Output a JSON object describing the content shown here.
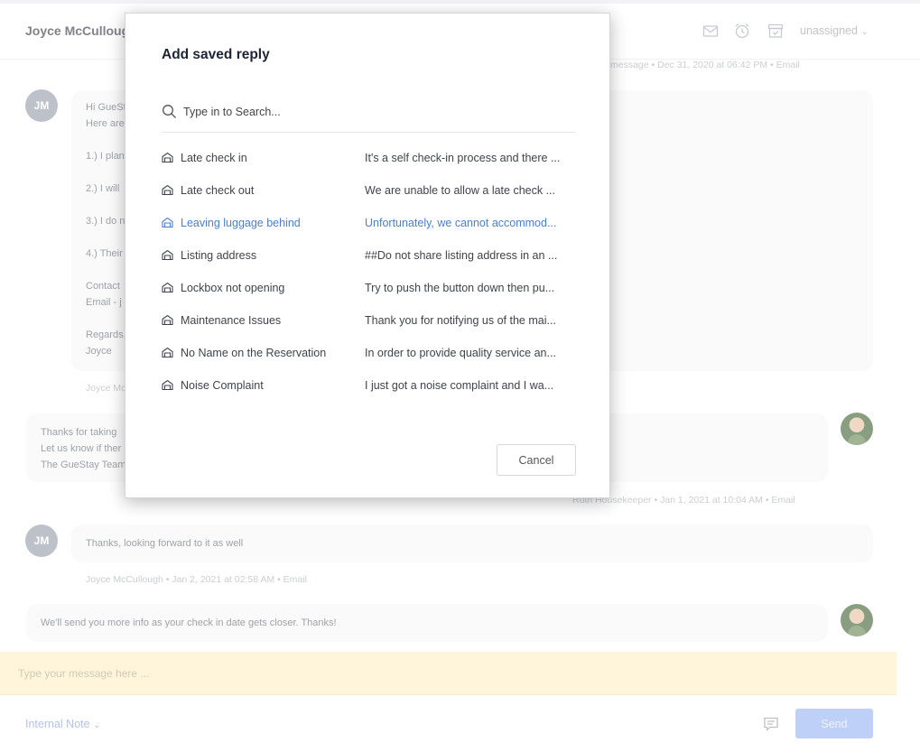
{
  "header": {
    "guest_name": "Joyce McCullough",
    "assignee": "unassigned"
  },
  "conversation": {
    "msg1": {
      "avatar": "JM",
      "meta": "message • Dec 31, 2020 at 06:42 PM • Email",
      "lines": [
        "Hi GueSt",
        "Here are",
        "",
        "1.) I plan",
        "",
        "2.) I will",
        "",
        "3.) I do n",
        "",
        "4.) Their",
        "",
        "Contact",
        "Email - j",
        "",
        "Regards,",
        "Joyce"
      ],
      "footer": "Joyce Mc"
    },
    "msg2": {
      "lines": [
        "Thanks for taking",
        "Let us know if ther",
        "The GueStay Team"
      ],
      "meta": "Ruth Housekeeper • Jan 1, 2021 at 10:04 AM • Email"
    },
    "msg3": {
      "avatar": "JM",
      "text": "Thanks, looking forward to it as well",
      "meta": "Joyce McCullough • Jan 2, 2021 at 02:58 AM • Email"
    },
    "msg4": {
      "text": "We'll send you more info as your check in date gets closer. Thanks!"
    }
  },
  "composer": {
    "placeholder": "Type your message here ...",
    "mode": "Internal Note",
    "send_label": "Send"
  },
  "modal": {
    "title": "Add saved reply",
    "search_placeholder": "Type in to Search...",
    "cancel_label": "Cancel",
    "replies": [
      {
        "name": "Late check in",
        "preview": "It's a self check-in process and there ..."
      },
      {
        "name": "Late check out",
        "preview": "We are unable to allow a late check ..."
      },
      {
        "name": "Leaving luggage behind",
        "preview": "Unfortunately, we cannot accommod..."
      },
      {
        "name": "Listing address",
        "preview": "##Do not share listing address in an ..."
      },
      {
        "name": "Lockbox not opening",
        "preview": "Try to push the button down then pu..."
      },
      {
        "name": "Maintenance Issues",
        "preview": "Thank you for notifying us of the mai..."
      },
      {
        "name": "No Name on the Reservation",
        "preview": "In order to provide quality service an..."
      },
      {
        "name": "Noise Complaint",
        "preview": "I just got a noise complaint and I wa..."
      }
    ]
  },
  "colors": {
    "accent": "#4a7fcf",
    "send_button": "#9cb6f4",
    "composer_bg": "#fdf0c6",
    "avatar_bg": "#9aa0ac"
  },
  "icons": {
    "reply_item": "saved-reply-icon",
    "search": "search-icon",
    "header": [
      "mail-icon",
      "alarm-clock-icon",
      "archive-icon"
    ],
    "composer": "chat-bubble-icon"
  }
}
